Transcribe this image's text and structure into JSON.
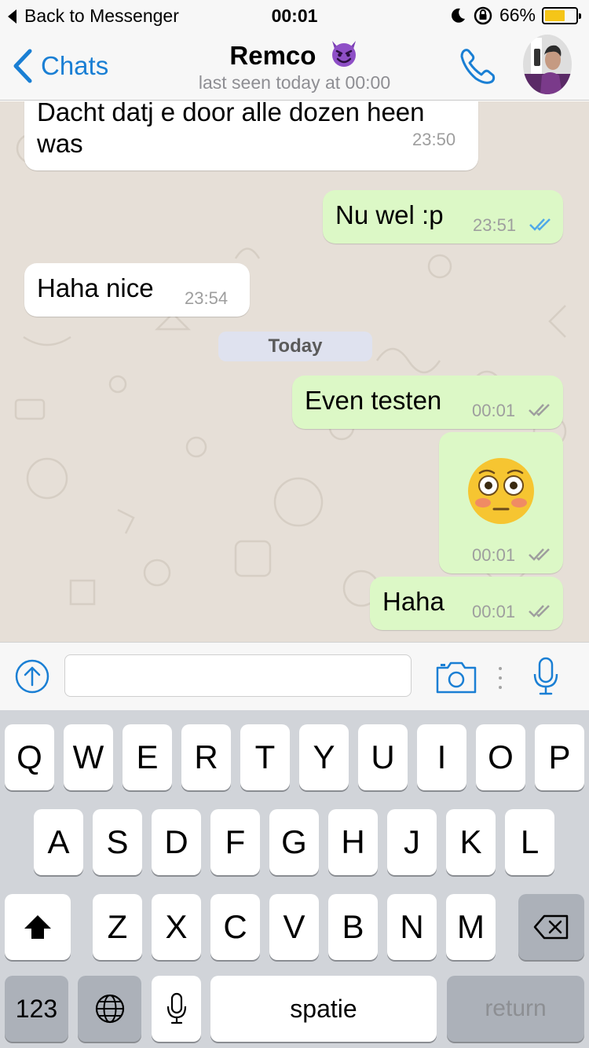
{
  "status_bar": {
    "back_label": "Back to Messenger",
    "time": "00:01",
    "battery_percent": "66%",
    "battery_level": 0.66,
    "icons": [
      "moon-icon",
      "rotation-lock-icon",
      "battery-icon"
    ]
  },
  "nav": {
    "back_label": "Chats",
    "title": "Remco",
    "title_emoji": "smiling-devil-emoji",
    "subtitle": "last seen today at 00:00"
  },
  "messages": [
    {
      "direction": "in",
      "text_line1": "Dacht datj e door alle dozen heen",
      "text_line2": "was",
      "time": "23:50"
    },
    {
      "direction": "out",
      "text": "Nu wel :p",
      "time": "23:51",
      "status": "read"
    },
    {
      "direction": "in",
      "text": "Haha nice",
      "time": "23:54"
    },
    {
      "direction": "out",
      "text": "Even testen",
      "time": "00:01",
      "status": "delivered"
    },
    {
      "direction": "out",
      "emoji": "flushed-face-emoji",
      "time": "00:01",
      "status": "delivered"
    },
    {
      "direction": "out",
      "text": "Haha",
      "time": "00:01",
      "status": "delivered"
    }
  ],
  "day_divider": "Today",
  "input": {
    "value": "",
    "placeholder": ""
  },
  "keyboard": {
    "row1": [
      "Q",
      "W",
      "E",
      "R",
      "T",
      "Y",
      "U",
      "I",
      "O",
      "P"
    ],
    "row2": [
      "A",
      "S",
      "D",
      "F",
      "G",
      "H",
      "J",
      "K",
      "L"
    ],
    "row3": [
      "Z",
      "X",
      "C",
      "V",
      "B",
      "N",
      "M"
    ],
    "numbers_label": "123",
    "space_label": "spatie",
    "return_label": "return"
  },
  "colors": {
    "accent": "#1a7fd4",
    "outgoing_bubble": "#dcf8c6",
    "incoming_bubble": "#ffffff",
    "chat_background": "#e6dfd7",
    "read_ticks": "#4fc3f7",
    "delivered_ticks": "#9e9e9e"
  }
}
